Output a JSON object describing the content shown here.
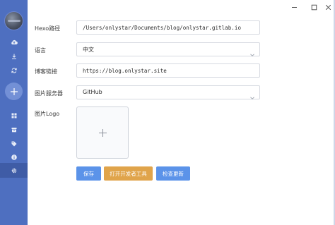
{
  "window": {
    "controls": [
      "minimize-icon",
      "maximize-icon",
      "close-icon"
    ]
  },
  "sidebar": {
    "avatar": "avatar",
    "top_icons": [
      "cloud-upload-icon",
      "download-icon",
      "sync-icon"
    ],
    "add_icon": "plus-icon",
    "bottom_icons": [
      "grid-icon",
      "archive-icon",
      "tag-icon",
      "info-icon",
      "gear-icon"
    ],
    "active_item": "gear-icon"
  },
  "form": {
    "hexo_path": {
      "label": "Hexo路径",
      "value": "/Users/onlystar/Documents/blog/onlystar.gitlab.io"
    },
    "language": {
      "label": "语言",
      "value": "中文"
    },
    "blog_link": {
      "label": "博客链接",
      "value": "https://blog.onlystar.site"
    },
    "image_server": {
      "label": "图片服务器",
      "value": "GitHub"
    },
    "image_logo": {
      "label": "图片Logo"
    }
  },
  "buttons": {
    "save": "保存",
    "open_devtools": "打开开发者工具",
    "check_update": "检查更新"
  },
  "colors": {
    "sidebar": "#4e6fc0",
    "primary": "#5b93e9",
    "warning": "#e0a44b"
  }
}
